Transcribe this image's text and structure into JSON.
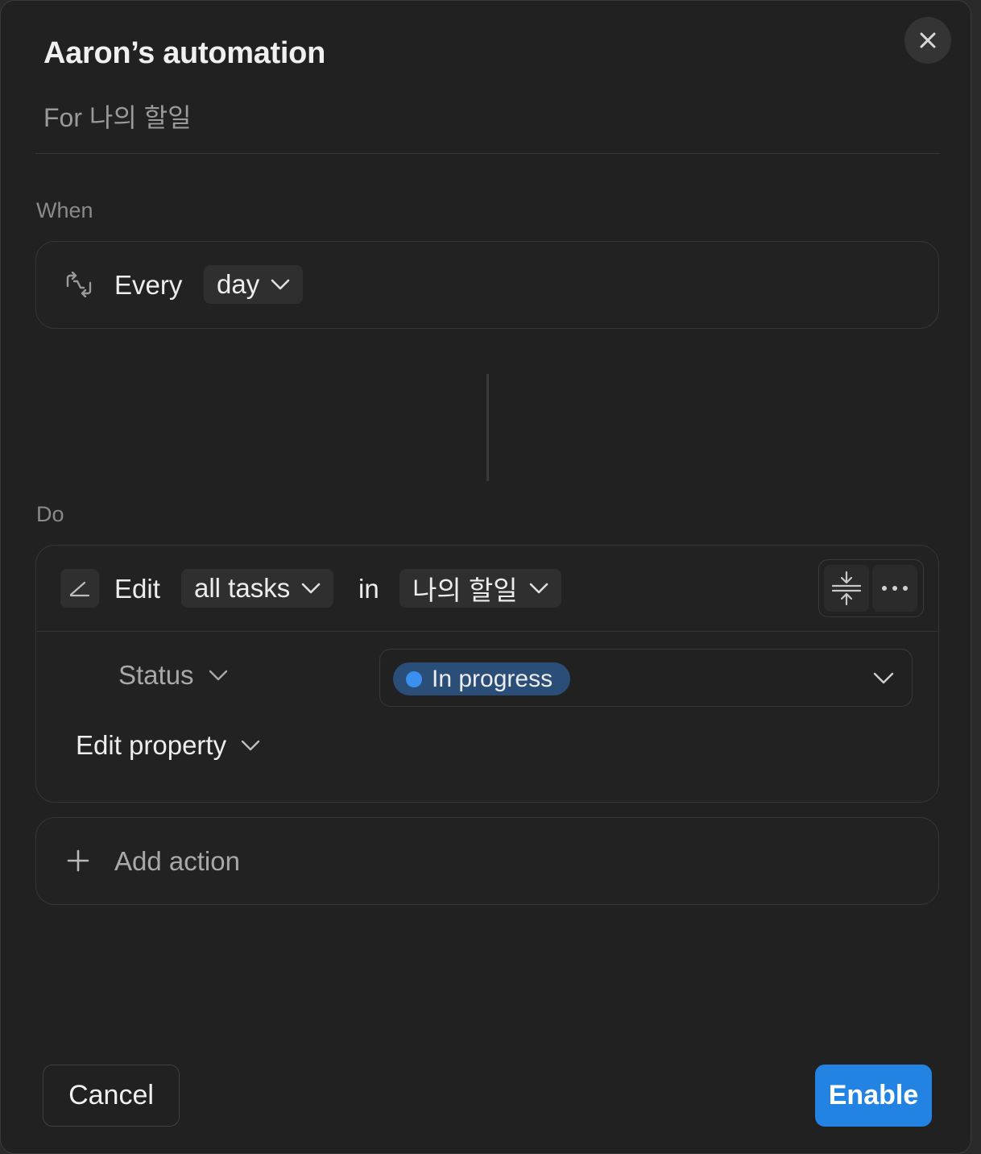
{
  "header": {
    "title": "Aaron’s automation",
    "subtitle": "For 나의 할일"
  },
  "trigger": {
    "section_label": "When",
    "prefix": "Every",
    "frequency": "day"
  },
  "action": {
    "section_label": "Do",
    "verb": "Edit",
    "target": "all tasks",
    "preposition": "in",
    "database": "나의 할일",
    "property_name": "Status",
    "property_value": "In progress",
    "edit_property_label": "Edit property"
  },
  "add_action_label": "Add action",
  "footer": {
    "cancel_label": "Cancel",
    "enable_label": "Enable"
  },
  "colors": {
    "accent": "#2383e2",
    "status_dot": "#3b8ff0",
    "status_bg": "#2a4e78"
  }
}
